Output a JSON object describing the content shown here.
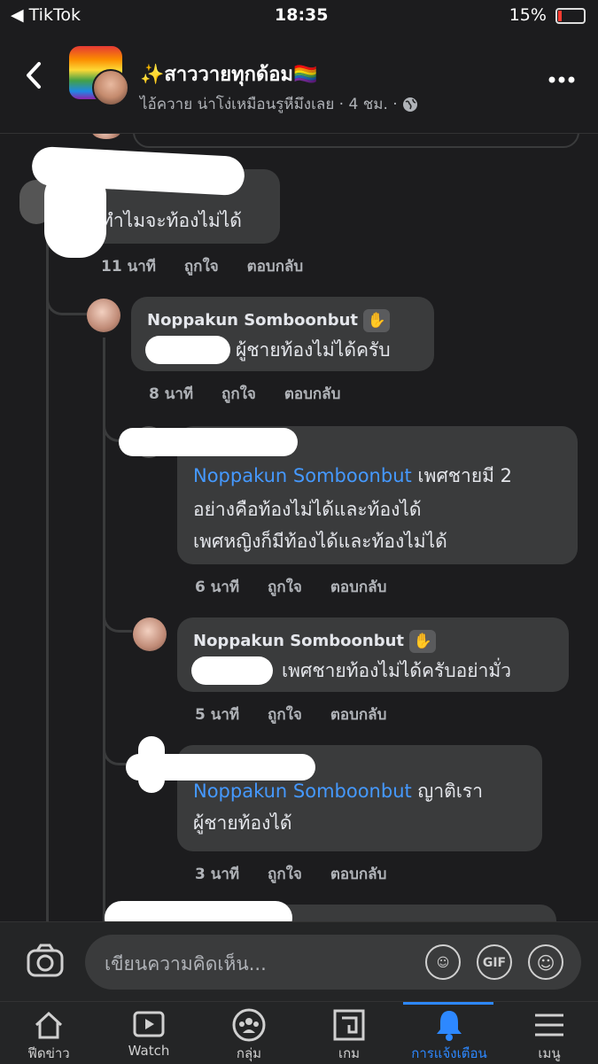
{
  "status": {
    "back_app": "◀ TikTok",
    "time": "18:35",
    "battery": "15%"
  },
  "header": {
    "group_name": "✨สาววายทุกด้อม🏳️‍🌈",
    "subtitle": "ไอ้ควาย น่าโง่เหมือนรูหีมึงเลย · 4 ชม. ·"
  },
  "comments": {
    "c1": {
      "text": "ทำไมจะท้องไม่ได้",
      "time": "11 นาที",
      "like": "ถูกใจ",
      "reply": "ตอบกลับ"
    },
    "c2": {
      "name": "Noppakun Somboonbut",
      "text": "ผู้ชายท้องไม่ได้ครับ",
      "time": "8 นาที",
      "like": "ถูกใจ",
      "reply": "ตอบกลับ"
    },
    "c3": {
      "mention": "Noppakun Somboonbut",
      "text1": " เพศชายมี 2",
      "text2": "อย่างคือท้องไม่ได้และท้องได้",
      "text3": "เพศหญิงก็มีท้องได้และท้องไม่ได้",
      "time": "6 นาที",
      "like": "ถูกใจ",
      "reply": "ตอบกลับ"
    },
    "c4": {
      "name": "Noppakun Somboonbut",
      "text": "เพศชายท้องไม่ได้ครับอย่ามั่ว",
      "time": "5 นาที",
      "like": "ถูกใจ",
      "reply": "ตอบกลับ"
    },
    "c5": {
      "mention": "Noppakun Somboonbut",
      "text1": " ญาติเรา",
      "text2": "ผู้ชายท้องได้",
      "time": "3 นาที",
      "like": "ถูกใจ",
      "reply": "ตอบกลับ"
    }
  },
  "composer": {
    "placeholder": "เขียนความคิดเห็น...",
    "gif": "GIF"
  },
  "nav": [
    {
      "label": "ฟีดข่าว",
      "icon": "home-icon"
    },
    {
      "label": "Watch",
      "icon": "watch-icon"
    },
    {
      "label": "กลุ่ม",
      "icon": "groups-icon"
    },
    {
      "label": "เกม",
      "icon": "gaming-icon"
    },
    {
      "label": "การแจ้งเตือน",
      "icon": "bell-icon"
    },
    {
      "label": "เมนู",
      "icon": "menu-icon"
    }
  ],
  "colors": {
    "accent": "#2d88ff",
    "mention": "#4599ff",
    "bubble": "#3a3b3c"
  }
}
